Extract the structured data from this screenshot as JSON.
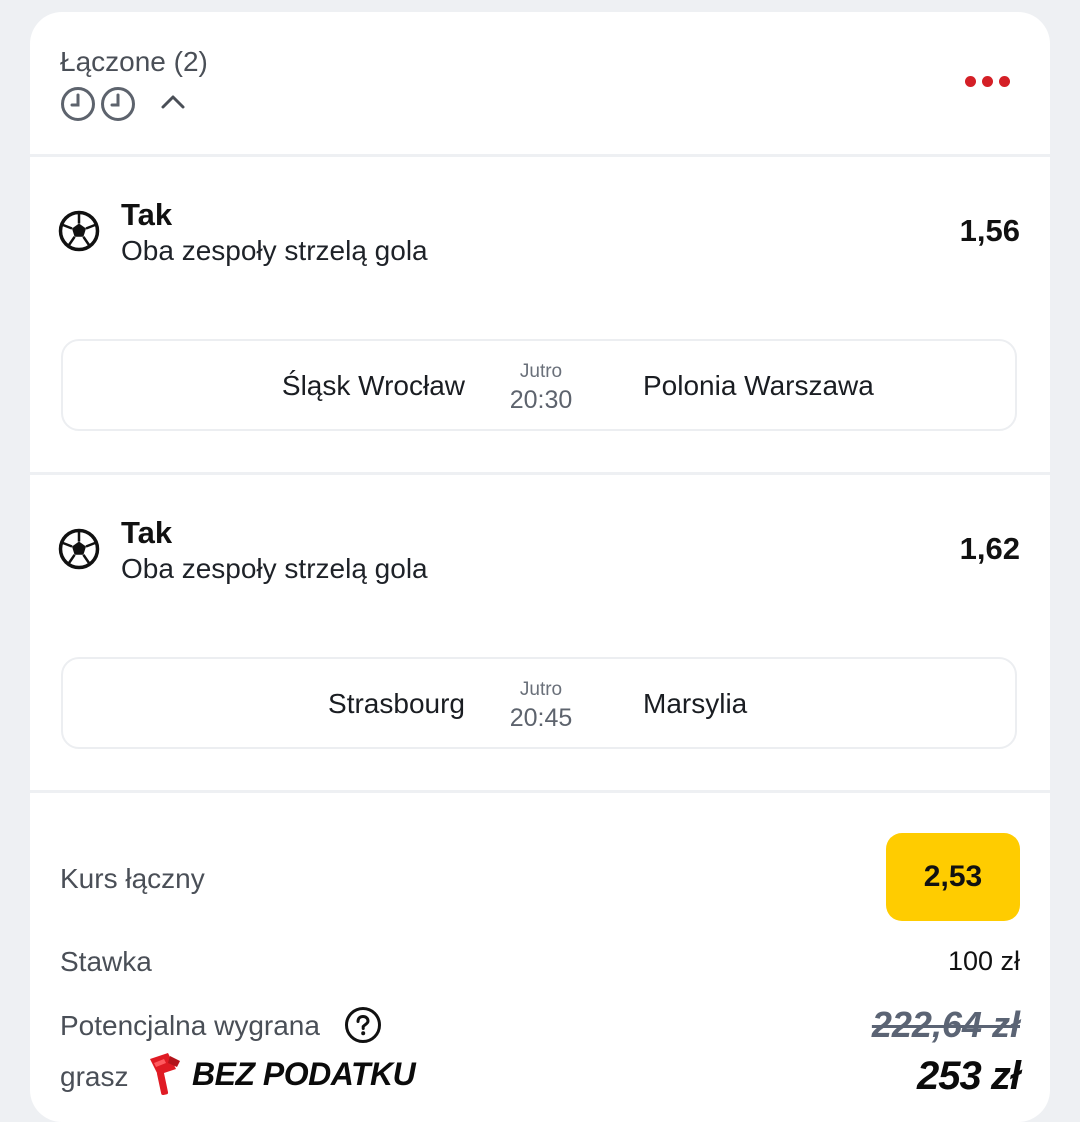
{
  "header": {
    "title": "Łączone (2)",
    "icons": [
      "clock-icon",
      "clock-icon",
      "chevron-up-icon",
      "more-icon"
    ],
    "accent_color": "#d41f26"
  },
  "selections": [
    {
      "pick": "Tak",
      "market": "Oba zespoły strzelą gola",
      "odd": "1,56",
      "home": "Śląsk Wrocław",
      "day": "Jutro",
      "time": "20:30",
      "away": "Polonia Warszawa"
    },
    {
      "pick": "Tak",
      "market": "Oba zespoły strzelą gola",
      "odd": "1,62",
      "home": "Strasbourg",
      "day": "Jutro",
      "time": "20:45",
      "away": "Marsylia"
    }
  ],
  "summary": {
    "total_odds_label": "Kurs łączny",
    "total_odds": "2,53",
    "total_badge_color": "#ffcc00",
    "stake_label": "Stawka",
    "stake": "100 zł",
    "potential_label": "Potencjalna wygrana",
    "potential_old": "222,64 zł",
    "grasz_label": "grasz",
    "tax_free": "BEZ PODATKU",
    "potential_new": "253 zł"
  }
}
